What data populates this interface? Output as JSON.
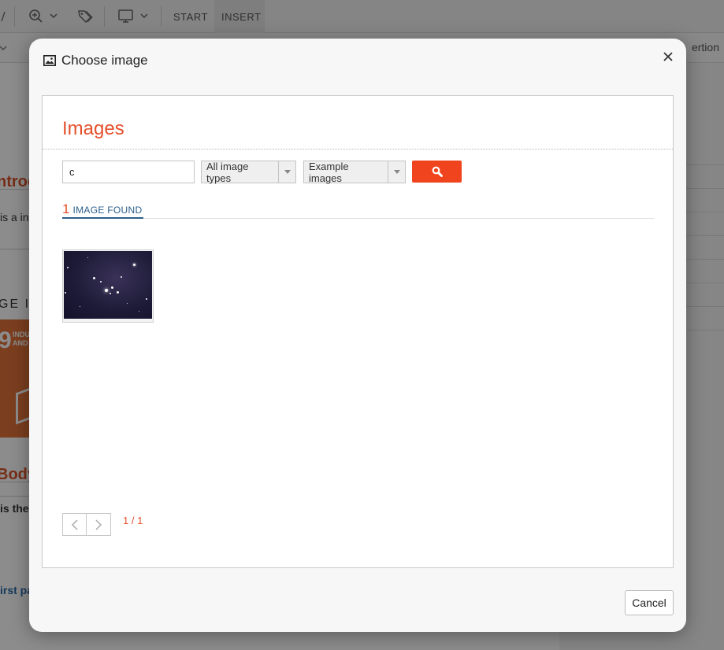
{
  "background": {
    "toolbar": {
      "start_label": "START",
      "insert_label": "INSERT"
    },
    "subbar_text": "ertion",
    "heading_fragment": "ntroc",
    "text_fragment": "is a in",
    "section_label_fragment": "GE IN",
    "sdg_number": "9",
    "sdg_text": "INDU AND",
    "body_heading_fragment": "Body",
    "bold_text_fragment": "is the",
    "link_fragment": "irst pa"
  },
  "modal": {
    "title": "Choose image",
    "panel_title": "Images",
    "search": {
      "value": "c",
      "placeholder": ""
    },
    "image_type_select": "All image types",
    "source_select": "Example images",
    "results": {
      "count": "1",
      "label": "IMAGE FOUND"
    },
    "pagination": {
      "page_info": "1 / 1"
    },
    "cancel_label": "Cancel"
  },
  "colors": {
    "accent": "#e5502b",
    "search_button": "#f0441f",
    "results_label": "#2b5f8c"
  },
  "icons": {
    "title_icon": "image-icon",
    "close": "close-icon",
    "search": "search-icon",
    "prev": "chevron-left-icon",
    "next": "chevron-right-icon"
  }
}
